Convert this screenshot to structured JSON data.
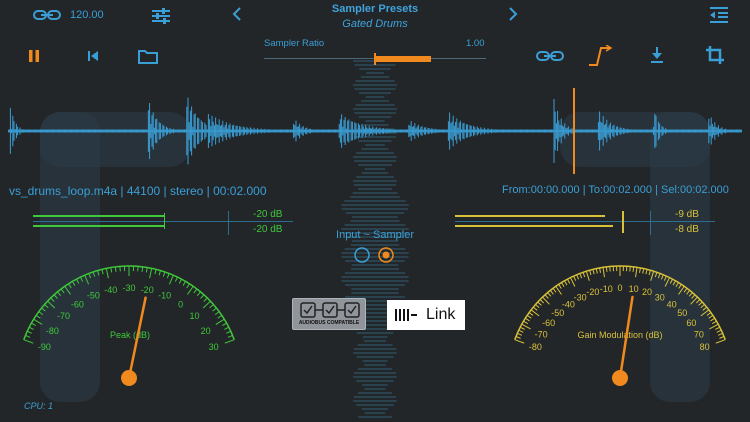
{
  "header": {
    "link_value": "120.00",
    "preset_title": "Sampler Presets",
    "preset_name": "Gated Drums"
  },
  "ratio": {
    "label": "Sampler Ratio",
    "value": "1.00",
    "level": 0.5
  },
  "file_info": "vs_drums_loop.m4a | 44100 | stereo  | 00:02.000",
  "selection_info": "From:00:00.000 | To:00:02.000 | Sel:00:02.000",
  "meters": {
    "left": {
      "db_top": "-20 dB",
      "db_bottom": "-20 dB"
    },
    "right": {
      "db_top": "-9 dB",
      "db_bottom": "-8 dB"
    }
  },
  "route_label": "Input ~ Sampler",
  "peak_gauge": {
    "label": "Peak (dB)",
    "ticks": [
      "-90",
      "-80",
      "-70",
      "-60",
      "-50",
      "-40",
      "-30",
      "-20",
      "-10",
      "0",
      "10",
      "20",
      "30"
    ],
    "value": -20
  },
  "gain_gauge": {
    "label": "Gain Modulation (dB)",
    "ticks": [
      "-80",
      "-70",
      "-60",
      "-50",
      "-40",
      "-30",
      "-20",
      "-10",
      "0",
      "10",
      "20",
      "30",
      "40",
      "50",
      "60",
      "70",
      "80"
    ],
    "value": 10
  },
  "badges": {
    "audiobus": "AUDIOBUS COMPATIBLE",
    "link": "Link"
  },
  "cpu": "CPU: 1",
  "colors": {
    "accent": "#3a9fd6",
    "orange": "#f08a1e",
    "green": "#3ec83a",
    "yellow": "#d8c23a"
  }
}
